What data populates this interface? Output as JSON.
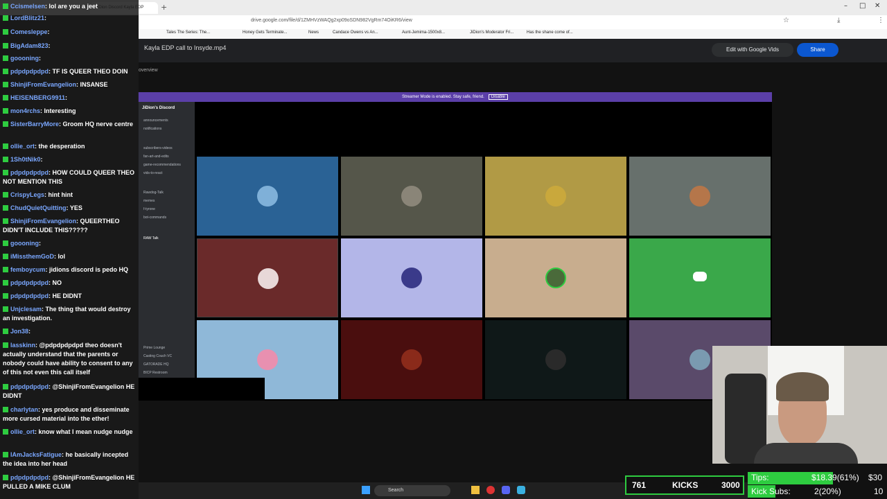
{
  "browser": {
    "url": "drive.google.com/file/d/1ZMHVzWAQg2xp09oSDN982VgRm74OiKR6/view",
    "bookmarks": [
      "Tales The Series: The...",
      "Honey Gets Terminate...",
      "News",
      "Candace Owens vs An...",
      "Aunt-Jemima-1500x8...",
      "JiDion's Moderator Fri...",
      "Has the shane come of..."
    ],
    "tab_title": "JiDion Discord Kayla EDP"
  },
  "drive": {
    "file_name": "Kayla EDP call to Insyde.mp4",
    "edit_label": "Edit with Google Vids",
    "share_label": "Share",
    "overview_label": "overview"
  },
  "discord": {
    "streamer_text": "Streamer Mode is enabled. Stay safe, friend.",
    "disable_label": "Disable",
    "server_name": "JiDion's Discord",
    "channels": [
      "announcements",
      "notifications",
      "subscribers-videos",
      "fan-art-and-edits",
      "game-recommendations",
      "vids-to-react",
      "Rawdog-Talk",
      "memes",
      "f-tyrone",
      "bot-commands",
      "RAW Talk",
      "Prime Lounge",
      "Casting Couch VC",
      "GATORADE HQ",
      "BICP Restroom"
    ]
  },
  "chat": [
    {
      "user": "Ccismelsen",
      "text": "lol are you a jeet"
    },
    {
      "user": "LordBlitz21",
      "text": ""
    },
    {
      "user": "Comesleppe",
      "text": ""
    },
    {
      "user": "BigAdam823",
      "text": ""
    },
    {
      "user": "goooning",
      "text": ""
    },
    {
      "user": "pdpdpdpdpd",
      "text": "TF IS QUEER THEO DOIN"
    },
    {
      "user": "ShinjiFromEvangelion",
      "text": "INSANSE"
    },
    {
      "user": "HEISENBERG9911",
      "text": ""
    },
    {
      "user": "mon4rchs",
      "text": "Interesting"
    },
    {
      "user": "SisterBarryMore",
      "text": "Groom HQ nerve centre"
    },
    {
      "user": "ollie_ort",
      "text": "the desperation"
    },
    {
      "user": "1Sh0tNik0",
      "text": ""
    },
    {
      "user": "pdpdpdpdpd",
      "text": "HOW COULD QUEER THEO NOT MENTION THIS"
    },
    {
      "user": "CrispyLegs",
      "text": "hint hint"
    },
    {
      "user": "ChudQuietQuitting",
      "text": "YES"
    },
    {
      "user": "ShinjiFromEvangelion",
      "text": "QUEERTHEO DIDN'T INCLUDE THIS?????"
    },
    {
      "user": "goooning",
      "text": ""
    },
    {
      "user": "iMissthemGoD",
      "text": "lol"
    },
    {
      "user": "femboycum",
      "text": "jidions discord is pedo HQ"
    },
    {
      "user": "pdpdpdpdpd",
      "text": "NO"
    },
    {
      "user": "pdpdpdpdpd",
      "text": "HE DIDNT"
    },
    {
      "user": "Unjclesam",
      "text": "The thing that would destroy an investigation."
    },
    {
      "user": "Jon38",
      "text": ""
    },
    {
      "user": "lasskinn",
      "text": "@pdpdpdpdpd theo doesn't actually understand that the parents or nobody could have ability to consent to any of this not even this call itself"
    },
    {
      "user": "pdpdpdpdpd",
      "text": "@ShinjiFromEvangelion HE DIDNT"
    },
    {
      "user": "charlytan",
      "text": "yes produce and disseminate more cursed material into the ether!"
    },
    {
      "user": "ollie_ort",
      "text": "know what I mean nudge nudge"
    },
    {
      "user": "IAmJacksFatigue",
      "text": "he basically incepted the idea into her head"
    },
    {
      "user": "pdpdpdpdpd",
      "text": "@ShinjiFromEvangelion HE PULLED A MIKE CLUM"
    }
  ],
  "taskbar": {
    "search_label": "Search"
  },
  "kicks": {
    "left": "761",
    "label": "KICKS",
    "right": "3000"
  },
  "tips": {
    "tips_label": "Tips:",
    "tips_value": "$18.39(61%)",
    "tips_goal": "$30",
    "subs_label": "Kick Subs:",
    "subs_value": "2(20%)",
    "subs_goal": "10",
    "tips_fraction": 0.61,
    "subs_fraction": 0.2
  },
  "colors": {
    "streamer_bar": "#5b3fa8",
    "kick_green": "#2ecc40",
    "username": "#7aa7ff"
  }
}
